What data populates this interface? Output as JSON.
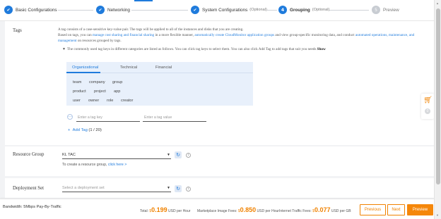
{
  "steps": [
    {
      "label": "Basic Configurations",
      "state": "done",
      "marker": "✔"
    },
    {
      "label": "Networking",
      "state": "done",
      "marker": "✔"
    },
    {
      "label": "System Configurations",
      "optional": "(Optional)",
      "state": "done",
      "marker": "✔"
    },
    {
      "label": "Grouping",
      "optional": "(Optional)",
      "state": "current",
      "marker": "4"
    },
    {
      "label": "Preview",
      "state": "todo",
      "marker": "5"
    }
  ],
  "tags": {
    "title": "Tags",
    "desc1": "A tag consists of a case-sensitive key-value pair. The tags will be applied to all of the instances and disks that you are creating.",
    "desc2_a": "Based on tags, you can ",
    "desc2_link1": "manage cost sharing and financial sharing",
    "desc2_b": " in a more flexible manner, ",
    "desc2_link2": "automatically create CloudMonitor application groups",
    "desc2_c": " and view group-specific monitoring data, and conduct ",
    "desc2_link3": "automated operations, maintenance, and",
    "desc3_link": "management",
    "desc3_b": " on resources grouped by tags.",
    "common_intro": "The commonly used tag keys in different categories are listed as follows. You can click tag keys to select them. You can also click Add Tag to add tags that suit you needs",
    "common_show": "Show",
    "tabs": [
      "Organizational",
      "Technical",
      "Financial"
    ],
    "keys_row1": [
      "team",
      "company",
      "group"
    ],
    "keys_row2": [
      "product",
      "project",
      "app"
    ],
    "keys_row3": [
      "user",
      "owner",
      "role",
      "creator"
    ],
    "key_placeholder": "Enter a tag key",
    "value_placeholder": "Enter a tag value",
    "add_tag_label": "Add Tag",
    "add_tag_count": "(1 / 20)"
  },
  "resource_group": {
    "title": "Resource Group",
    "selected": "KL TAC",
    "hint_prefix": "To create a resource group,",
    "hint_link": "click here >"
  },
  "deployment_set": {
    "title": "Deployment Set",
    "placeholder": "Select a deployment set"
  },
  "footer": {
    "bandwidth": "Bandwidth: 5Mbps Pay-By-Traffic",
    "total_label": "Total:",
    "total_currency": "$",
    "total_amount": "0.199",
    "total_unit": "USD per Hour",
    "mkt_label": "Marketplace Image Fees:",
    "mkt_currency": "$",
    "mkt_amount": "0.850",
    "mkt_unit": "USD per Hour",
    "traffic_label": "Internet Traffic Fees:",
    "traffic_currency": "$",
    "traffic_amount": "0.077",
    "traffic_unit": "USD per GB",
    "previous": "Previous",
    "next": "Next",
    "preview": "Preview"
  },
  "cart": {
    "count": "0"
  },
  "colors": {
    "accent": "#1f7bdc",
    "price": "#f08200"
  }
}
